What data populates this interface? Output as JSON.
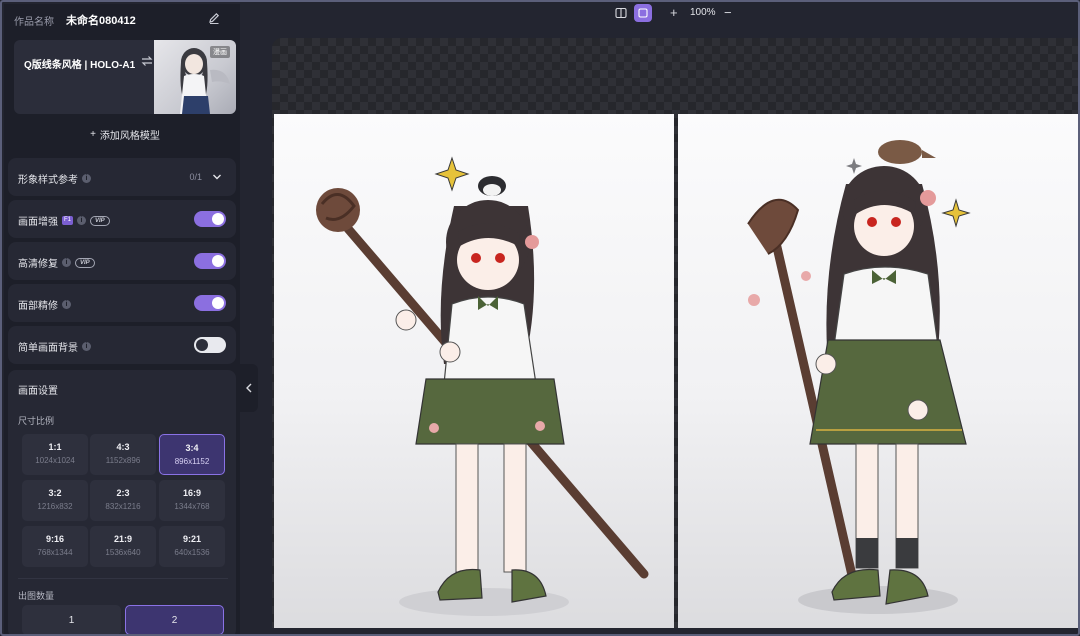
{
  "work": {
    "label": "作品名称",
    "name": "未命名080412"
  },
  "model": {
    "name": "Q版线条风格 | HOLO-A1",
    "tag": "漫画"
  },
  "add_model": {
    "label": "添加风格模型"
  },
  "options": {
    "reference": {
      "label": "形象样式参考",
      "count": "0/1"
    },
    "enhance": {
      "label": "画面增强",
      "badge": "F1",
      "vip": "VIP",
      "enabled": true
    },
    "hires": {
      "label": "高清修复",
      "vip": "VIP",
      "enabled": true
    },
    "face": {
      "label": "面部精修",
      "enabled": true
    },
    "simple_bg": {
      "label": "简单画面背景",
      "enabled": false
    }
  },
  "settings": {
    "title": "画面设置",
    "size_label": "尺寸比例",
    "ratios": [
      {
        "ratio": "1:1",
        "size": "1024x1024"
      },
      {
        "ratio": "4:3",
        "size": "1152x896"
      },
      {
        "ratio": "3:4",
        "size": "896x1152"
      },
      {
        "ratio": "3:2",
        "size": "1216x832"
      },
      {
        "ratio": "2:3",
        "size": "832x1216"
      },
      {
        "ratio": "16:9",
        "size": "1344x768"
      },
      {
        "ratio": "9:16",
        "size": "768x1344"
      },
      {
        "ratio": "21:9",
        "size": "1536x640"
      },
      {
        "ratio": "9:21",
        "size": "640x1536"
      }
    ],
    "selected_ratio": "3:4",
    "output_label": "出图数量",
    "output_options": [
      "1",
      "2"
    ],
    "selected_output": "2"
  },
  "toolbar": {
    "zoom": "100%"
  },
  "colors": {
    "accent": "#8b6fe0",
    "panel": "#262834",
    "sidebar": "#1d1f29"
  }
}
